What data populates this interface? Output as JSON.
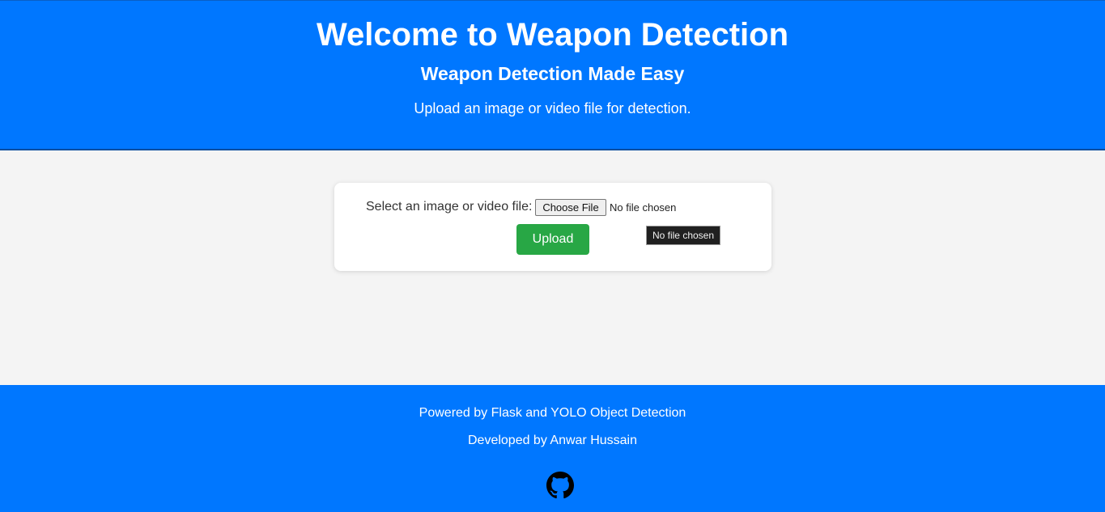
{
  "header": {
    "title": "Welcome to Weapon Detection",
    "subtitle": "Weapon Detection Made Easy",
    "tagline": "Upload an image or video file for detection."
  },
  "upload_form": {
    "file_label": "Select an image or video file:",
    "choose_file_label": "Choose File",
    "file_status": "No file chosen",
    "upload_label": "Upload"
  },
  "tooltip": {
    "text": "No file chosen"
  },
  "footer": {
    "powered_by": "Powered by Flask and YOLO Object Detection",
    "developer": "Developed by Anwar Hussain",
    "github_icon": "github-icon"
  },
  "colors": {
    "primary_blue": "#0077ff",
    "upload_green": "#28a745",
    "page_background": "#f4f4f4"
  }
}
